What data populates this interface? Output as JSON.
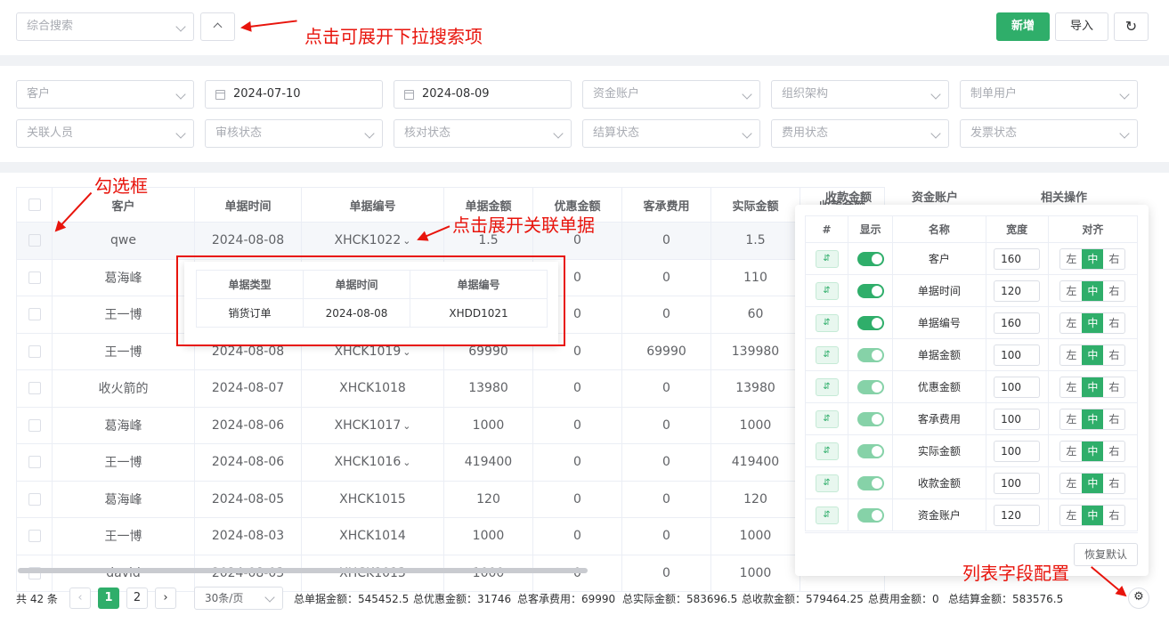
{
  "search": {
    "placeholder": "综合搜索",
    "add": "新增",
    "import": "导入"
  },
  "annotations": {
    "expand_search": "点击可展开下拉搜索项",
    "checkbox": "勾选框",
    "expand_related": "点击展开关联单据",
    "field_config": "列表字段配置"
  },
  "filters": {
    "customer": "客户",
    "date_start": "2024-07-10",
    "date_end": "2024-08-09",
    "fund_account": "资金账户",
    "org": "组织架构",
    "creator": "制单用户",
    "related_person": "关联人员",
    "audit_status": "审核状态",
    "check_status": "核对状态",
    "settle_status": "结算状态",
    "fee_status": "费用状态",
    "invoice_status": "发票状态"
  },
  "table": {
    "headers": [
      "客户",
      "单据时间",
      "单据编号",
      "单据金额",
      "优惠金额",
      "客承费用",
      "实际金额",
      "收款金额",
      "资金账户"
    ],
    "rows": [
      [
        "qwe",
        "2024-08-08",
        "XHCK1022",
        "1.5",
        "0",
        "0",
        "1.5"
      ],
      [
        "葛海峰",
        "",
        "",
        "",
        "0",
        "0",
        "110"
      ],
      [
        "王一博",
        "",
        "",
        "",
        "0",
        "0",
        "60"
      ],
      [
        "王一博",
        "2024-08-08",
        "XHCK1019",
        "69990",
        "0",
        "69990",
        "139980"
      ],
      [
        "收火箭的",
        "2024-08-07",
        "XHCK1018",
        "13980",
        "0",
        "0",
        "13980"
      ],
      [
        "葛海峰",
        "2024-08-06",
        "XHCK1017",
        "1000",
        "0",
        "0",
        "1000"
      ],
      [
        "王一博",
        "2024-08-06",
        "XHCK1016",
        "419400",
        "0",
        "0",
        "419400"
      ],
      [
        "葛海峰",
        "2024-08-05",
        "XHCK1015",
        "120",
        "0",
        "0",
        "120"
      ],
      [
        "王一博",
        "2024-08-03",
        "XHCK1014",
        "1000",
        "0",
        "0",
        "1000"
      ],
      [
        "david",
        "2024-08-03",
        "XHCK1013",
        "1000",
        "0",
        "0",
        "1000"
      ]
    ]
  },
  "related": {
    "headers": [
      "单据类型",
      "单据时间",
      "单据编号"
    ],
    "row": [
      "销货订单",
      "2024-08-08",
      "XHDD1021"
    ]
  },
  "config": {
    "headers": [
      "#",
      "显示",
      "名称",
      "宽度",
      "对齐"
    ],
    "align": [
      "左",
      "中",
      "右"
    ],
    "reset": "恢复默认",
    "rows": [
      {
        "name": "客户",
        "width": "160"
      },
      {
        "name": "单据时间",
        "width": "120"
      },
      {
        "name": "单据编号",
        "width": "160"
      },
      {
        "name": "单据金额",
        "width": "100"
      },
      {
        "name": "优惠金额",
        "width": "100"
      },
      {
        "name": "客承费用",
        "width": "100"
      },
      {
        "name": "实际金额",
        "width": "100"
      },
      {
        "name": "收款金额",
        "width": "100"
      },
      {
        "name": "资金账户",
        "width": "120"
      }
    ],
    "partial_headers": [
      "收款金额",
      "资金账户",
      "相关操作"
    ]
  },
  "footer": {
    "total": "共 42 条",
    "page1": "1",
    "page2": "2",
    "page_size": "30条/页",
    "sum_amount": "总单据金额：545452.5",
    "sum_discount": "总优惠金额：31746",
    "sum_fee": "总客承费用：69990",
    "sum_actual": "总实际金额：583696.5",
    "sum_received": "总收款金额：579464.25",
    "sum_expense": "总费用金额：0",
    "sum_settle": "总结算金额：583576.5"
  },
  "colors": {
    "accent": "#2fae6a",
    "annotation": "#e8140c"
  }
}
